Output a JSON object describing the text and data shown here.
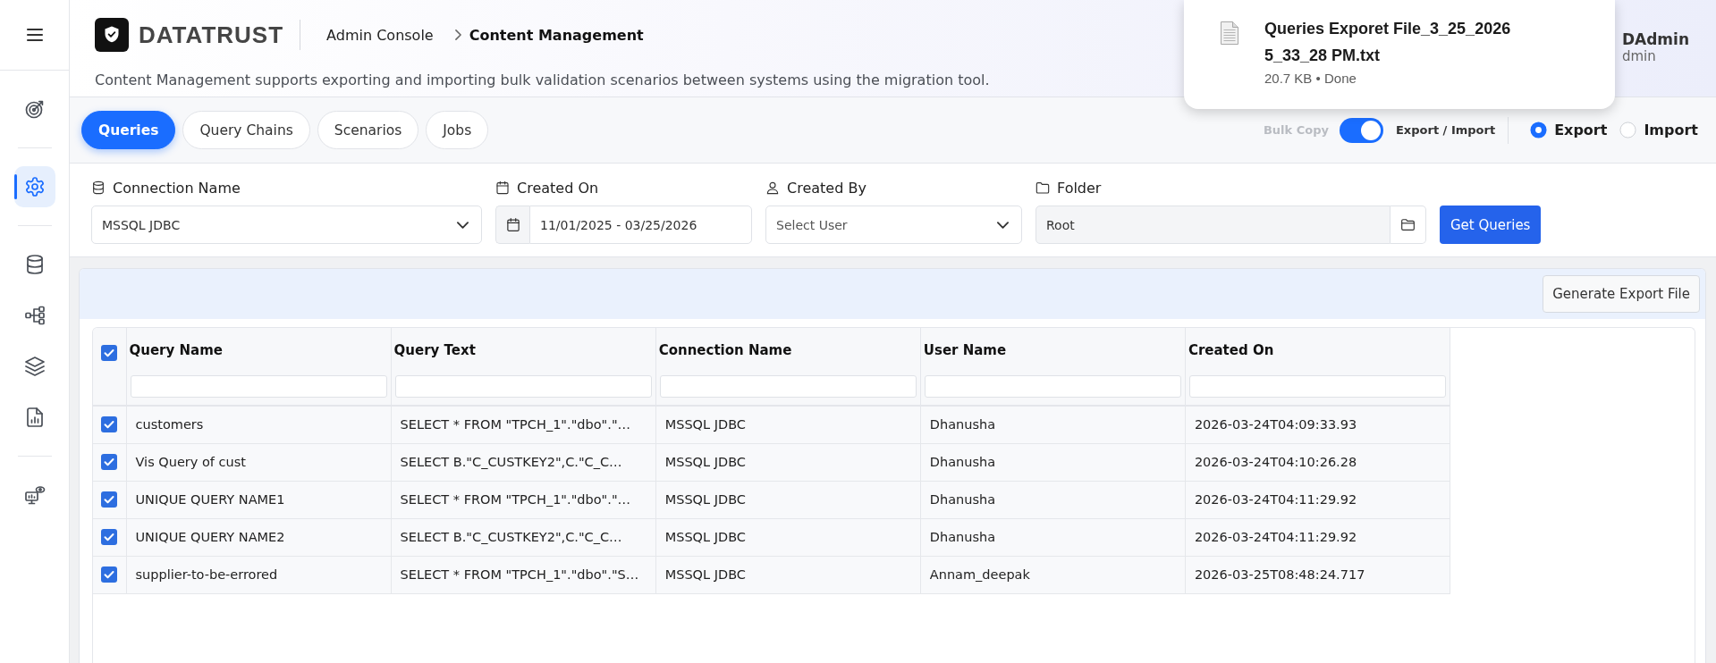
{
  "sidebar": {
    "sections": [
      {
        "items": [
          {
            "selected": false
          }
        ]
      },
      {
        "items": [
          {
            "selected": true
          }
        ]
      },
      {
        "items": [
          {
            "selected": false
          },
          {
            "selected": false
          },
          {
            "selected": false
          },
          {
            "selected": false
          }
        ]
      },
      {
        "items": [
          {
            "selected": false
          }
        ]
      }
    ]
  },
  "header": {
    "logo_text": "DATATRUST",
    "breadcrumb": [
      "Admin Console",
      "Content Management"
    ],
    "description": "Content Management supports exporting and importing bulk validation scenarios between systems using the migration tool.",
    "user": {
      "name": "DAdmin",
      "role": "dmin"
    }
  },
  "download_popup": {
    "file_name": "Queries Exporet File_3_25_2026 5_33_28 PM.txt",
    "status": "20.7 KB • Done"
  },
  "tabs": [
    {
      "label": "Queries",
      "selected": true
    },
    {
      "label": "Query Chains",
      "selected": false
    },
    {
      "label": "Scenarios",
      "selected": false
    },
    {
      "label": "Jobs",
      "selected": false
    }
  ],
  "transfer": {
    "bulk_copy_label": "Bulk Copy",
    "toggle_on": true,
    "toggle_label": "Export / Import",
    "options": [
      {
        "label": "Export",
        "selected": true
      },
      {
        "label": "Import",
        "selected": false
      }
    ]
  },
  "filters": [
    {
      "kind": "select",
      "label": "Connection Name",
      "value": "MSSQL JDBC"
    },
    {
      "kind": "date-range",
      "label": "Created On",
      "value": "11/01/2025 - 03/25/2026"
    },
    {
      "kind": "select",
      "label": "Created By",
      "placeholder": "Select User"
    },
    {
      "kind": "folder",
      "label": "Folder",
      "value": "Root"
    }
  ],
  "get_queries_button": "Get Queries",
  "export_button": "Generate Export File",
  "table": {
    "all_selected": true,
    "columns": [
      "Query Name",
      "Query Text",
      "Connection Name",
      "User Name",
      "Created On"
    ],
    "rows": [
      {
        "selected": true,
        "cells": [
          "customers",
          "SELECT * FROM \"TPCH_1\".\"dbo\".\"…",
          "MSSQL JDBC",
          "Dhanusha",
          "2026-03-24T04:09:33.93"
        ]
      },
      {
        "selected": true,
        "cells": [
          "Vis Query of cust",
          "SELECT B.\"C_CUSTKEY2\",C.\"C_C…",
          "MSSQL JDBC",
          "Dhanusha",
          "2026-03-24T04:10:26.28"
        ]
      },
      {
        "selected": true,
        "cells": [
          "UNIQUE QUERY NAME1",
          "SELECT * FROM \"TPCH_1\".\"dbo\".\"…",
          "MSSQL JDBC",
          "Dhanusha",
          "2026-03-24T04:11:29.92"
        ]
      },
      {
        "selected": true,
        "cells": [
          "UNIQUE QUERY NAME2",
          "SELECT B.\"C_CUSTKEY2\",C.\"C_C…",
          "MSSQL JDBC",
          "Dhanusha",
          "2026-03-24T04:11:29.92"
        ]
      },
      {
        "selected": true,
        "cells": [
          "supplier-to-be-errored",
          "SELECT * FROM \"TPCH_1\".\"dbo\".\"S…",
          "MSSQL JDBC",
          "Annam_deepak",
          "2026-03-25T08:48:24.717"
        ]
      }
    ]
  }
}
